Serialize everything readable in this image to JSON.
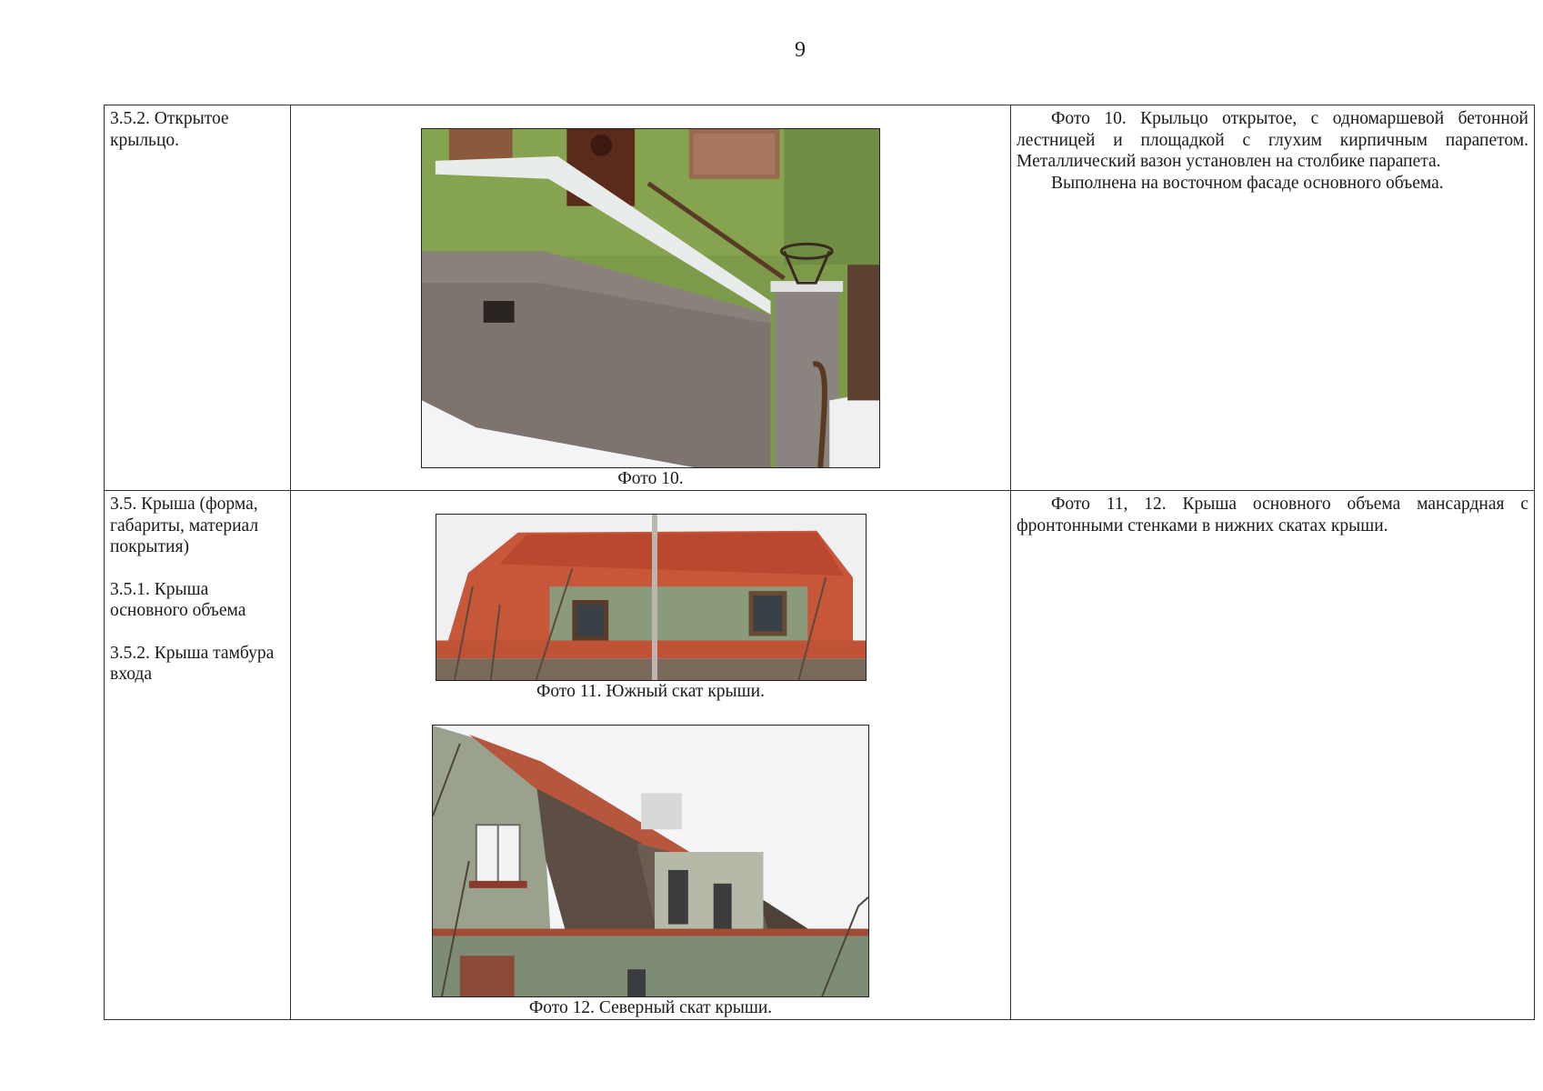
{
  "page_number": "9",
  "rows": [
    {
      "labels": [
        "3.5.2. Открытое крыльцо."
      ],
      "photos": [
        {
          "caption": "Фото 10.",
          "subject": "open-porch-photo"
        }
      ],
      "description": [
        "Фото 10. Крыльцо открытое, с одномаршевой бетонной лестницей и площадкой с глухим кирпичным парапетом. Металлический вазон установлен на столбике парапета.",
        "Выполнена на восточном фасаде основного объема."
      ]
    },
    {
      "labels": [
        "3.5. Крыша (форма, габариты, материал покрытия)",
        "3.5.1. Крыша основного объема",
        "3.5.2. Крыша тамбура входа"
      ],
      "photos": [
        {
          "caption": "Фото 11. Южный скат крыши.",
          "subject": "south-roof-slope-photo"
        },
        {
          "caption": "Фото 12. Северный скат крыши.",
          "subject": "north-roof-slope-photo"
        }
      ],
      "description": [
        "Фото 11, 12. Крыша основного объема мансардная с фронтонными стенками в нижних скатах крыши."
      ]
    }
  ]
}
